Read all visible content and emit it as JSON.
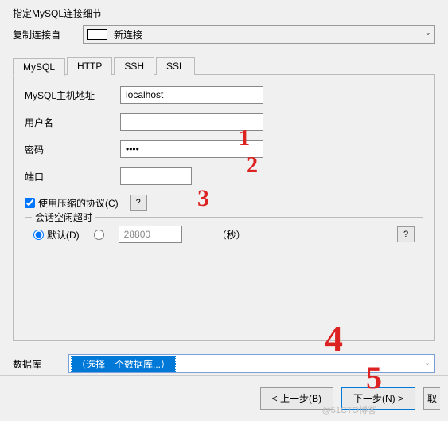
{
  "subtitle": "指定MySQL连接细节",
  "copyFrom": {
    "label": "复制连接自",
    "value": "新连接"
  },
  "tabs": {
    "mysql": "MySQL",
    "http": "HTTP",
    "ssh": "SSH",
    "ssl": "SSL"
  },
  "form": {
    "host": {
      "label": "MySQL主机地址",
      "value": "localhost"
    },
    "user": {
      "label": "用户名",
      "value": ""
    },
    "pass": {
      "label": "密码",
      "value": "••••"
    },
    "port": {
      "label": "端口",
      "value": ""
    },
    "compress": {
      "label": "使用压缩的协议(C)",
      "help": "?"
    },
    "idle": {
      "legend": "会话空闲超时",
      "default": "默认(D)",
      "custom_value": "28800",
      "unit": "（秒）",
      "help": "?"
    }
  },
  "database": {
    "label": "数据库",
    "value": "（选择一个数据库...）"
  },
  "footer": {
    "back": "< 上一步(B)",
    "next": "下一步(N) >",
    "cancel": "取"
  },
  "watermark": "@51CTO博客",
  "annotations": {
    "a1": "1",
    "a2": "2",
    "a3": "3",
    "a4": "4",
    "a5": "5"
  }
}
